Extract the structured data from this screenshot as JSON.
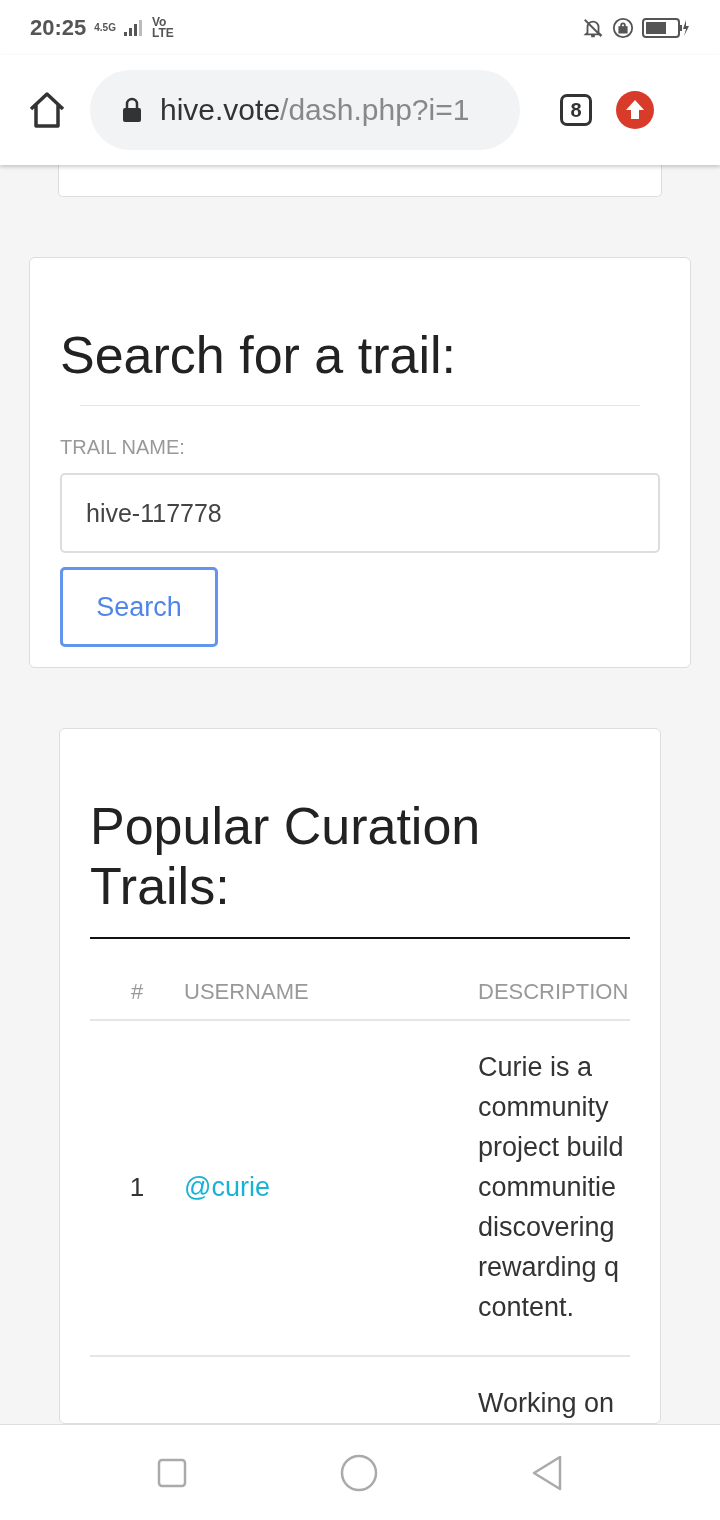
{
  "status_bar": {
    "time": "20:25",
    "network": "4.5G",
    "volte": "Vo LTE"
  },
  "browser": {
    "url_host": "hive.vote",
    "url_path": "/dash.php?i=1",
    "tab_count": "8"
  },
  "search_card": {
    "title": "Search for a trail:",
    "field_label": "TRAIL NAME:",
    "field_value": "hive-117778",
    "button": "Search"
  },
  "trails_card": {
    "title": "Popular Curation Trails:",
    "columns": [
      "#",
      "USERNAME",
      "DESCRIPTION"
    ],
    "rows": [
      {
        "rank": "1",
        "username": "@curie",
        "description": [
          "Curie is a",
          "community",
          "project build",
          "communitie",
          "discovering",
          "rewarding q",
          "content."
        ]
      },
      {
        "rank": "",
        "username": "",
        "description": [
          "Working on"
        ]
      }
    ]
  }
}
